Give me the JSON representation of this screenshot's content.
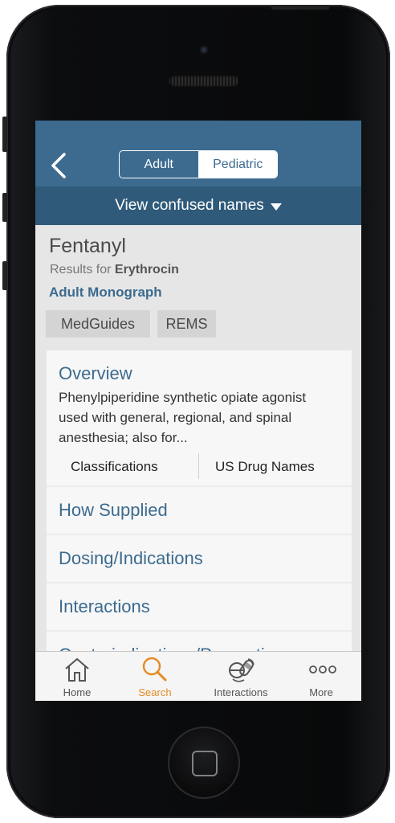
{
  "header": {
    "segments": [
      "Adult",
      "Pediatric"
    ],
    "confused_names": "View confused names"
  },
  "drug": {
    "name": "Fentanyl",
    "results_prefix": "Results for",
    "results_term": "Erythrocin",
    "monograph": "Adult Monograph",
    "tags": [
      "MedGuides",
      "REMS"
    ]
  },
  "overview": {
    "title": "Overview",
    "text": "Phenylpiperidine synthetic opiate agonist used with general, regional, and spinal anesthesia; also for...",
    "links": [
      "Classifications",
      "US Drug Names"
    ]
  },
  "sections": [
    "How Supplied",
    "Dosing/Indications",
    "Interactions",
    "Contraindications/Precautions"
  ],
  "tabs": [
    "Home",
    "Search",
    "Interactions",
    "More"
  ],
  "colors": {
    "brand": "#3c6b8f",
    "active_tab": "#e58a22"
  }
}
